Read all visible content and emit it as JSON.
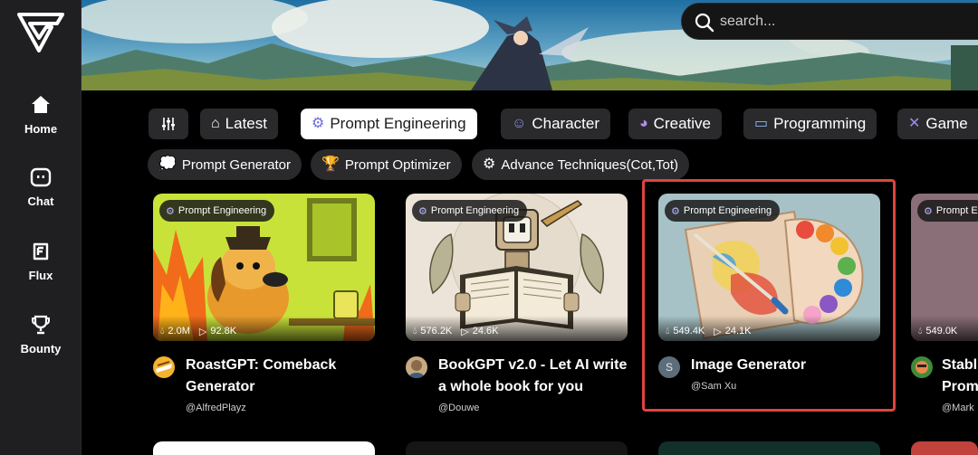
{
  "search": {
    "placeholder": "search..."
  },
  "nav": [
    {
      "label": "Home",
      "icon": "home-icon"
    },
    {
      "label": "Chat",
      "icon": "chat-icon"
    },
    {
      "label": "Flux",
      "icon": "flux-icon"
    },
    {
      "label": "Bounty",
      "icon": "trophy-icon"
    }
  ],
  "categories": [
    {
      "label": "",
      "icon": "filter-icon"
    },
    {
      "label": "Latest",
      "icon": "house-icon"
    },
    {
      "label": "Prompt Engineering",
      "icon": "gear-icon",
      "active": true
    },
    {
      "label": "Character",
      "icon": "smile-icon"
    },
    {
      "label": "Creative",
      "icon": "palette-icon"
    },
    {
      "label": "Programming",
      "icon": "monitor-icon"
    },
    {
      "label": "Game",
      "icon": "swords-icon"
    }
  ],
  "subcategories": [
    {
      "label": "Prompt Generator",
      "icon": "speech-bubble-icon"
    },
    {
      "label": "Prompt Optimizer",
      "icon": "trophy-icon"
    },
    {
      "label": "Advance Techniques(Cot,Tot)",
      "icon": "gear-icon"
    }
  ],
  "cards": [
    {
      "badge": "Prompt Engineering",
      "views": "2.0M",
      "plays": "92.8K",
      "title": "RoastGPT: Comeback Generator",
      "author": "@AlfredPlayz"
    },
    {
      "badge": "Prompt Engineering",
      "views": "576.2K",
      "plays": "24.6K",
      "title": "BookGPT v2.0 - Let AI write a whole book for you",
      "author": "@Douwe"
    },
    {
      "badge": "Prompt Engineering",
      "views": "549.4K",
      "plays": "24.1K",
      "title": "Image Generator",
      "author": "@Sam Xu",
      "avatar_letter": "S"
    },
    {
      "badge": "Prompt E",
      "views": "549.0K",
      "plays": "",
      "title": "Stabl",
      "title2": "Prom",
      "author": "@Mark"
    }
  ],
  "colors": {
    "highlight": "#e0443e",
    "sidebar": "#1f1f22",
    "chip": "#2a2a2d"
  }
}
